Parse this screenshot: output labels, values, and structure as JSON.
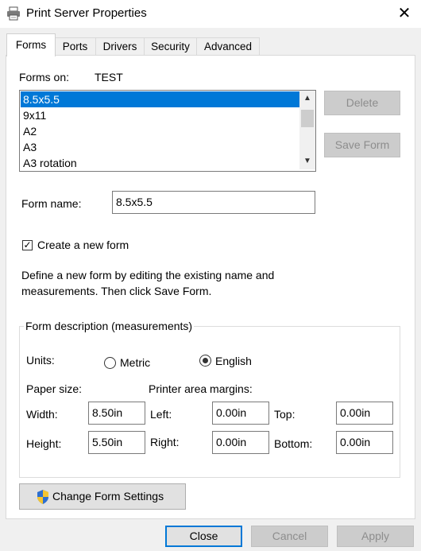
{
  "window": {
    "title": "Print Server Properties",
    "close_symbol": "✕"
  },
  "tabs": [
    {
      "label": "Forms",
      "active": true
    },
    {
      "label": "Ports",
      "active": false
    },
    {
      "label": "Drivers",
      "active": false
    },
    {
      "label": "Security",
      "active": false
    },
    {
      "label": "Advanced",
      "active": false
    }
  ],
  "forms_tab": {
    "forms_on_label": "Forms on:",
    "server_name": "TEST",
    "forms_list": [
      "8.5x5.5",
      "9x11",
      "A2",
      "A3",
      "A3 rotation"
    ],
    "selected_form": "8.5x5.5",
    "delete_button": "Delete",
    "save_form_button": "Save Form",
    "form_name_label": "Form name:",
    "form_name_value": "8.5x5.5",
    "create_new_form_label": "Create a new form",
    "create_new_form_checked": true,
    "description_line1": "Define a new form by editing the existing name and",
    "description_line2": "measurements. Then click Save Form.",
    "group_title": "Form description (measurements)",
    "units_label": "Units:",
    "units_metric": "Metric",
    "units_english": "English",
    "units_selected": "English",
    "paper_size_label": "Paper size:",
    "margins_label": "Printer area margins:",
    "width_label": "Width:",
    "width_value": "8.50in",
    "height_label": "Height:",
    "height_value": "5.50in",
    "left_label": "Left:",
    "left_value": "0.00in",
    "right_label": "Right:",
    "right_value": "0.00in",
    "top_label": "Top:",
    "top_value": "0.00in",
    "bottom_label": "Bottom:",
    "bottom_value": "0.00in",
    "change_settings_button": "Change Form Settings"
  },
  "footer": {
    "close_button": "Close",
    "cancel_button": "Cancel",
    "apply_button": "Apply"
  },
  "colors": {
    "accent": "#0078d7",
    "disabled_text": "#8d8d8d"
  },
  "icons": {
    "title": "printer-icon",
    "change_settings": "uac-shield-icon"
  }
}
